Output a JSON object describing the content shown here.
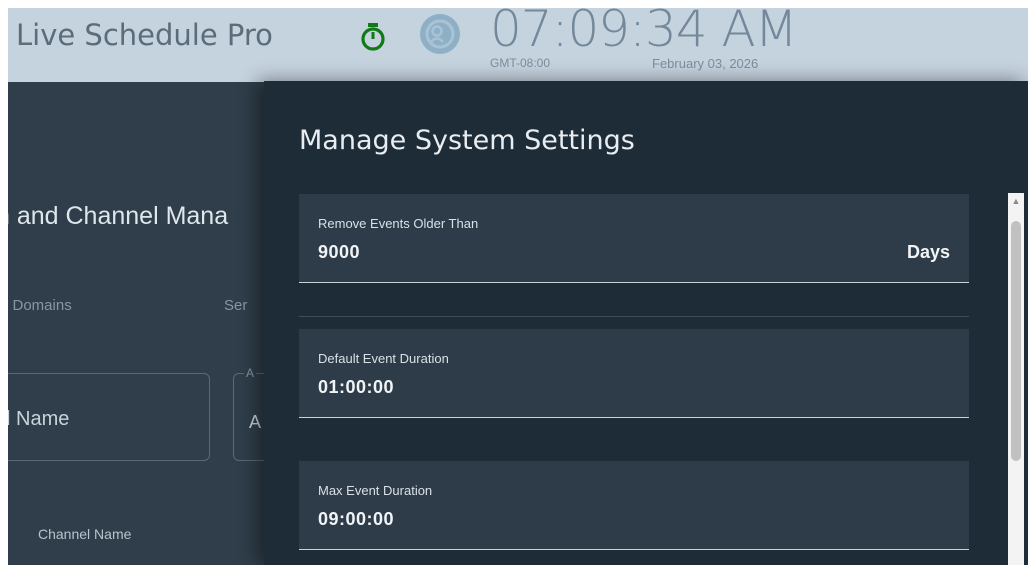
{
  "header": {
    "app_title": "Live Schedule Pro",
    "clock": {
      "time": "07:09:34 AM",
      "timezone": "GMT-08:00",
      "date": "February 03, 2026"
    },
    "icons": [
      "timer-icon",
      "user-icon"
    ]
  },
  "background_page": {
    "title": "n and Channel Mana",
    "tabs": [
      "e Domains",
      "Ser"
    ],
    "field_1_text": "l Name",
    "field_2_label": "A",
    "field_2_value": "A",
    "column_header": "Channel Name"
  },
  "modal": {
    "title": "Manage System Settings",
    "settings": [
      {
        "label": "Remove Events Older Than",
        "value": "9000",
        "unit": "Days"
      },
      {
        "label": "Default Event Duration",
        "value": "01:00:00"
      },
      {
        "label": "Max Event Duration",
        "value": "09:00:00"
      }
    ]
  },
  "colors": {
    "header_bg": "#c5d3df",
    "page_bg": "#2f3e4a",
    "modal_bg": "#1e2c37",
    "field_bg": "#2d3c48",
    "timer_green": "#0f7a16",
    "user_icon_blue": "#8eb0c6"
  }
}
